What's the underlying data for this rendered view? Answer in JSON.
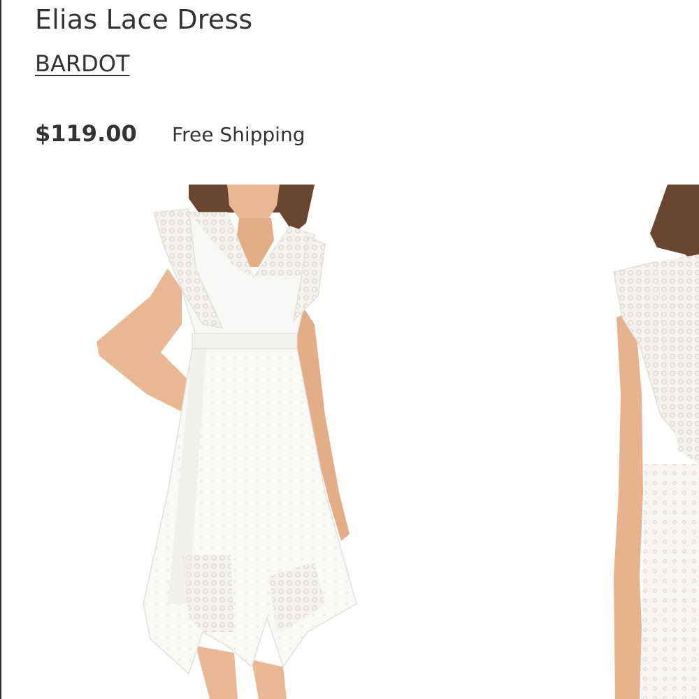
{
  "product": {
    "title": "Elias Lace Dress",
    "brand": "BARDOT",
    "price": "$119.00",
    "shipping": "Free Shipping"
  },
  "gallery": {
    "images": [
      {
        "description_name": "product-photo-front"
      },
      {
        "description_name": "product-photo-side"
      }
    ]
  },
  "colors": {
    "text": "#333333",
    "background": "#ffffff",
    "dress": "#f7f7f5",
    "skin": "#e8b894",
    "hair": "#6a4630"
  }
}
